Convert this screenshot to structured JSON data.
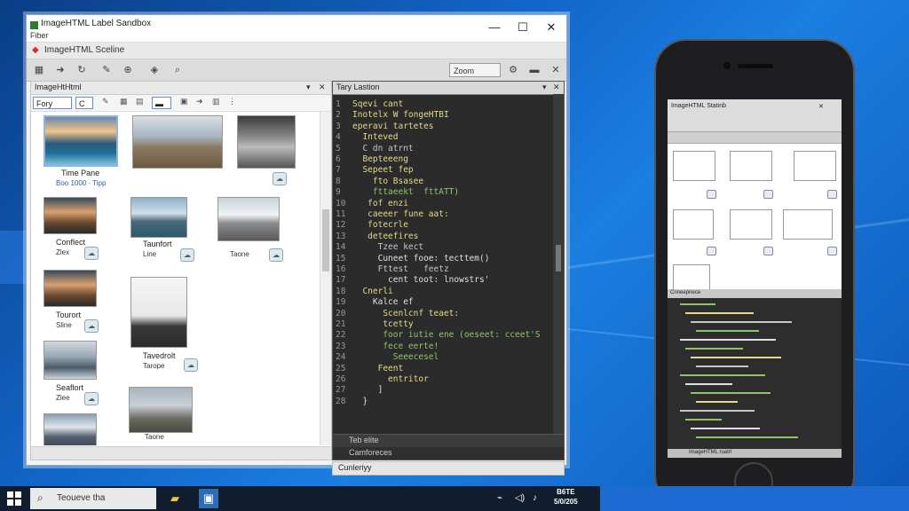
{
  "window": {
    "title": "ImageHTML Label Sandbox",
    "subtitle": "Fiber",
    "menu_title": "ImageHTML Sceline",
    "toolbar_field": "Zoom"
  },
  "left_panel": {
    "title": "ImageHtHtml",
    "filter_label": "Fory",
    "filter_value": "C",
    "thumbnails": [
      {
        "name": "Time Pane",
        "meta": "Boo 1000 · Tipp"
      },
      {
        "name": "",
        "meta": ""
      },
      {
        "name": "",
        "meta": ""
      },
      {
        "name": "Conflect",
        "meta": "Zlex"
      },
      {
        "name": "Taunfort",
        "meta": "Line"
      },
      {
        "name": "",
        "meta": "Taone"
      },
      {
        "name": "Tourort",
        "meta": "Sline"
      },
      {
        "name": "Tavedrolt",
        "meta": "Tarope"
      },
      {
        "name": "Seaflort",
        "meta": "Zlee"
      },
      {
        "name": "",
        "meta": "Taone"
      },
      {
        "name": "",
        "meta": ""
      }
    ]
  },
  "code_panel": {
    "title": "Tary Lastion",
    "lines": [
      {
        "n": "1",
        "t": "Sqevi cant",
        "c": "k1"
      },
      {
        "n": "2",
        "t": "Inotelx W fongeHTBI",
        "c": "k1"
      },
      {
        "n": "3",
        "t": "eperavi tartetes",
        "c": "k1"
      },
      {
        "n": "4",
        "t": "  Inteved",
        "c": "k1"
      },
      {
        "n": "5",
        "t": "  C dn atrnt",
        "c": "k2"
      },
      {
        "n": "6",
        "t": "  Bepteeeng",
        "c": "k1"
      },
      {
        "n": "7",
        "t": "  Sepeet fep",
        "c": "k1"
      },
      {
        "n": "8",
        "t": "    fto Bsasee",
        "c": "k1"
      },
      {
        "n": "9",
        "t": "    fttaeekt  fttATT)",
        "c": "k3"
      },
      {
        "n": "10",
        "t": "   fof enzi",
        "c": "k1"
      },
      {
        "n": "11",
        "t": "   caeeer fune aat:",
        "c": "k1"
      },
      {
        "n": "12",
        "t": "   fotecrle",
        "c": "k1"
      },
      {
        "n": "13",
        "t": "   deteefires",
        "c": "k1"
      },
      {
        "n": "14",
        "t": "     Tzee kect",
        "c": "k2"
      },
      {
        "n": "15",
        "t": "     Cuneet fooe: tecttem()",
        "c": "k4"
      },
      {
        "n": "16",
        "t": "     Fttest   feetz",
        "c": "k2"
      },
      {
        "n": "17",
        "t": "       cent toot: lnowstrs'",
        "c": "k4"
      },
      {
        "n": "18",
        "t": "  Cnerli",
        "c": "k1"
      },
      {
        "n": "19",
        "t": "    Kalce ef",
        "c": "k4"
      },
      {
        "n": "20",
        "t": "      Scenlcnf teaet:",
        "c": "k1"
      },
      {
        "n": "21",
        "t": "      tcetty",
        "c": "k1"
      },
      {
        "n": "22",
        "t": "      foor iutie ene (oeseet: cceet'S",
        "c": "k3"
      },
      {
        "n": "23",
        "t": "      fece eerte!",
        "c": "k3"
      },
      {
        "n": "24",
        "t": "        Seeecesel",
        "c": "k3"
      },
      {
        "n": "25",
        "t": "     Feent",
        "c": "k1"
      },
      {
        "n": "26",
        "t": "       entritor",
        "c": "k1"
      },
      {
        "n": "27",
        "t": "     ]",
        "c": "k4"
      },
      {
        "n": "28",
        "t": "  }",
        "c": "k4"
      }
    ],
    "status1": "Teb elite",
    "status2": "Camforeces",
    "bottom_label": "Cunleriyy"
  },
  "phone": {
    "title": "ImageHTML Statinb",
    "code_title": "Cnneepnece",
    "footer": "ImageHTML ruatrl"
  },
  "taskbar": {
    "search_text": "Teoueve tha",
    "clock_line1": "B6TE",
    "clock_line2": "5/0/205"
  },
  "colors": {
    "desktop": "#1266c9",
    "taskbar": "#0f1d2e",
    "editor_bg": "#2b2b2b",
    "code_yellow": "#e6d98a",
    "code_green": "#8cc66b"
  }
}
